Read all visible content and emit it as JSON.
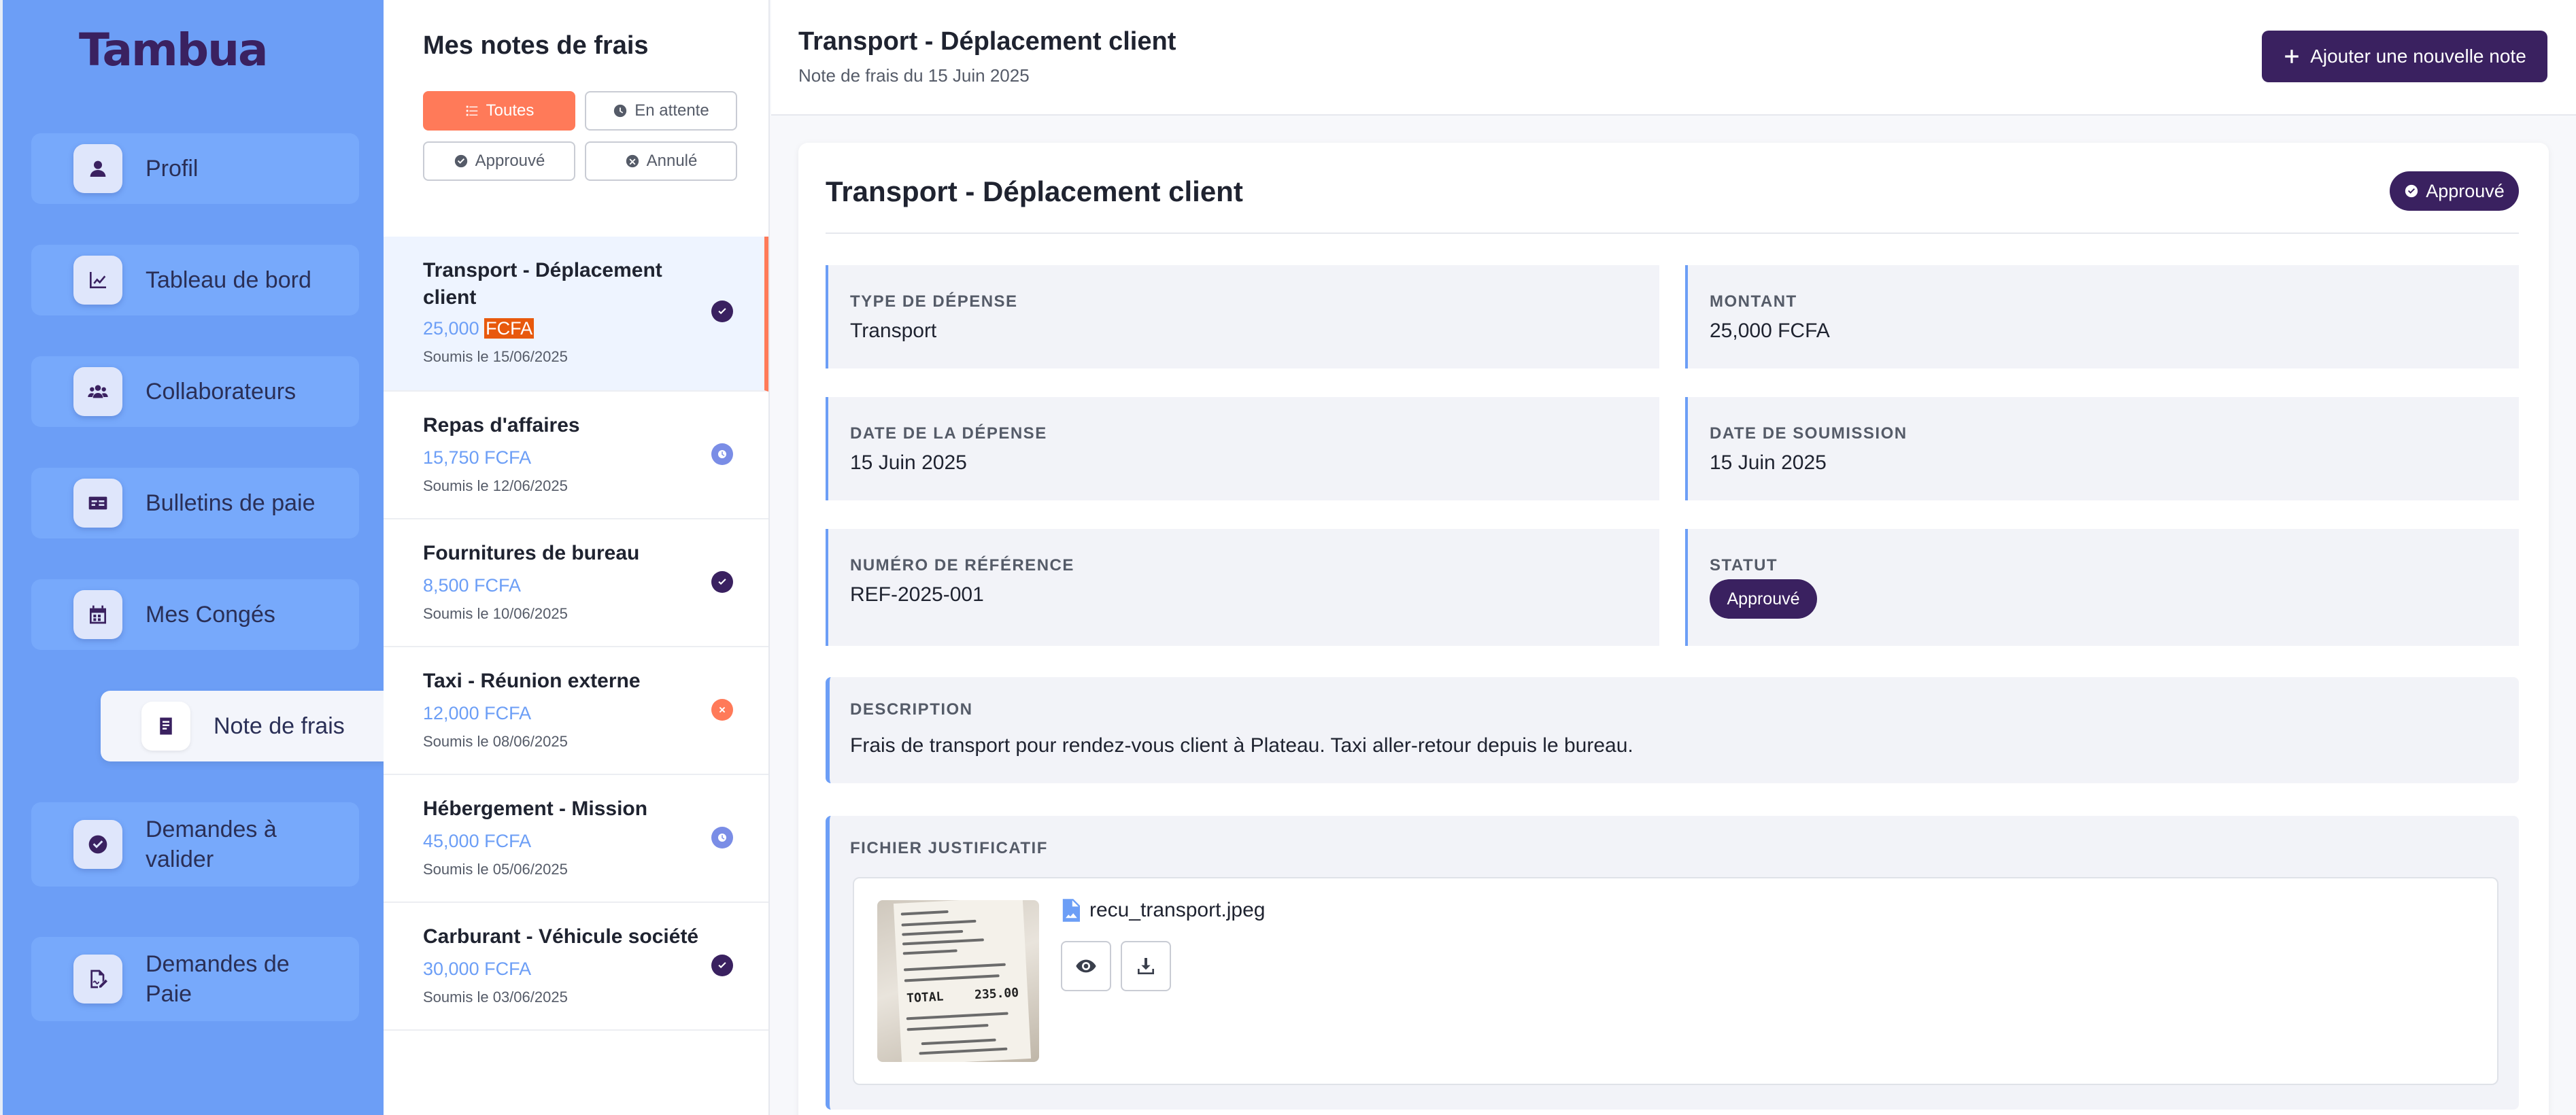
{
  "app": {
    "logo_text": "Tambua"
  },
  "sidebar": {
    "items": [
      {
        "label": "Profil",
        "icon": "user-icon"
      },
      {
        "label": "Tableau de bord",
        "icon": "chart-line-icon"
      },
      {
        "label": "Collaborateurs",
        "icon": "users-icon"
      },
      {
        "label": "Bulletins de paie",
        "icon": "id-card-icon"
      },
      {
        "label": "Mes Congés",
        "icon": "calendar-icon"
      },
      {
        "label": "Note de frais",
        "icon": "receipt-icon",
        "active": true
      },
      {
        "label": "Demandes à valider",
        "icon": "check-circle-icon"
      },
      {
        "label": "Demandes de Paie",
        "icon": "file-signature-icon"
      }
    ]
  },
  "notes_panel": {
    "title": "Mes notes de frais",
    "filters": [
      {
        "label": "Toutes",
        "icon": "list-icon",
        "active": true
      },
      {
        "label": "En attente",
        "icon": "clock-icon"
      },
      {
        "label": "Approuvé",
        "icon": "check-circle-icon"
      },
      {
        "label": "Annulé",
        "icon": "x-circle-icon"
      }
    ],
    "items": [
      {
        "title": "Transport - Déplacement client",
        "amount": "25,000",
        "currency": "FCFA",
        "submitted": "Soumis le 15/06/2025",
        "status": "approved",
        "selected": true
      },
      {
        "title": "Repas d'affaires",
        "amount": "15,750 FCFA",
        "submitted": "Soumis le 12/06/2025",
        "status": "pending"
      },
      {
        "title": "Fournitures de bureau",
        "amount": "8,500 FCFA",
        "submitted": "Soumis le 10/06/2025",
        "status": "approved"
      },
      {
        "title": "Taxi - Réunion externe",
        "amount": "12,000 FCFA",
        "submitted": "Soumis le 08/06/2025",
        "status": "cancelled"
      },
      {
        "title": "Hébergement - Mission",
        "amount": "45,000 FCFA",
        "submitted": "Soumis le 05/06/2025",
        "status": "pending"
      },
      {
        "title": "Carburant - Véhicule société",
        "amount": "30,000 FCFA",
        "submitted": "Soumis le 03/06/2025",
        "status": "approved"
      }
    ]
  },
  "header": {
    "title": "Transport - Déplacement client",
    "subtitle": "Note de frais du 15 Juin 2025",
    "add_button": "Ajouter une nouvelle note"
  },
  "detail": {
    "title": "Transport - Déplacement client",
    "status_badge": "Approuvé",
    "fields": {
      "type_label": "Type de dépense",
      "type_value": "Transport",
      "amount_label": "Montant",
      "amount_value": "25,000 FCFA",
      "expense_date_label": "Date de la dépense",
      "expense_date_value": "15 Juin 2025",
      "submission_date_label": "Date de soumission",
      "submission_date_value": "15 Juin 2025",
      "reference_label": "Numéro de référence",
      "reference_value": "REF-2025-001",
      "status_label": "Statut",
      "status_value": "Approuvé"
    },
    "description_label": "Description",
    "description_text": "Frais de transport pour rendez-vous client à Plateau. Taxi aller-retour depuis le bureau.",
    "attachment_label": "Fichier justificatif",
    "attachment_name": "recu_transport.jpeg",
    "receipt_total_label": "TOTAL",
    "receipt_total_value": "235.00"
  },
  "colors": {
    "sidebar_bg": "#6c9ef6",
    "brand_dark": "#3a2160",
    "accent_orange": "#ff7a59",
    "pending_blue": "#7a8de6"
  }
}
